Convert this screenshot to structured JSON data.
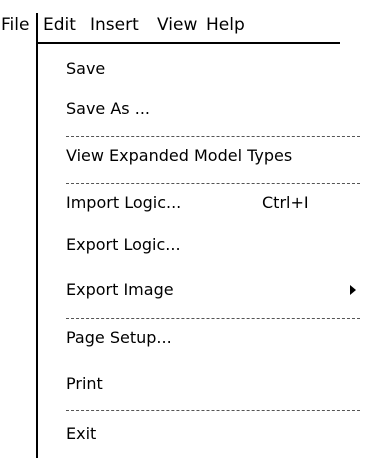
{
  "menubar": {
    "items": [
      "File",
      "Edit",
      "Insert",
      "View",
      "Help"
    ]
  },
  "file_menu": {
    "items": [
      {
        "label": "Save"
      },
      {
        "label": "Save As ..."
      },
      {
        "label": "View Expanded Model Types"
      },
      {
        "label": "Import Logic...",
        "shortcut": "Ctrl+I"
      },
      {
        "label": "Export Logic..."
      },
      {
        "label": "Export Image",
        "submenu": true
      },
      {
        "label": "Page Setup..."
      },
      {
        "label": "Print"
      },
      {
        "label": "Exit"
      }
    ]
  }
}
